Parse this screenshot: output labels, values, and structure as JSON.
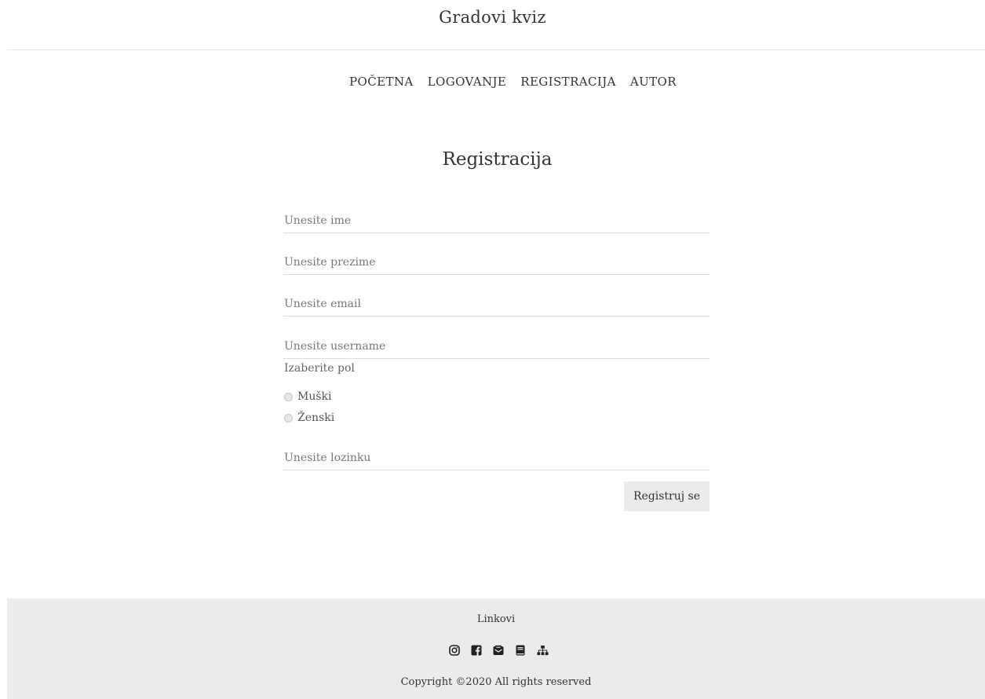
{
  "header": {
    "site_title": "Gradovi kviz"
  },
  "nav": {
    "items": [
      "POČETNA",
      "LOGOVANJE",
      "REGISTRACIJA",
      "AUTOR"
    ]
  },
  "main": {
    "heading": "Registracija",
    "fields": {
      "ime": {
        "placeholder": "Unesite ime",
        "value": ""
      },
      "prezime": {
        "placeholder": "Unesite prezime",
        "value": ""
      },
      "email": {
        "placeholder": "Unesite email",
        "value": ""
      },
      "username": {
        "placeholder": "Unesite username",
        "value": ""
      },
      "lozinka": {
        "placeholder": "Unesite lozinku",
        "value": ""
      }
    },
    "gender": {
      "label": "Izaberite pol",
      "options": [
        "Muški",
        "Ženski"
      ],
      "selected": null
    },
    "submit_label": "Registruj se"
  },
  "footer": {
    "title": "Linkovi",
    "icons": [
      "instagram-icon",
      "facebook-icon",
      "email-icon",
      "book-icon",
      "sitemap-icon"
    ],
    "copyright": "Copyright ©2020 All rights reserved"
  }
}
